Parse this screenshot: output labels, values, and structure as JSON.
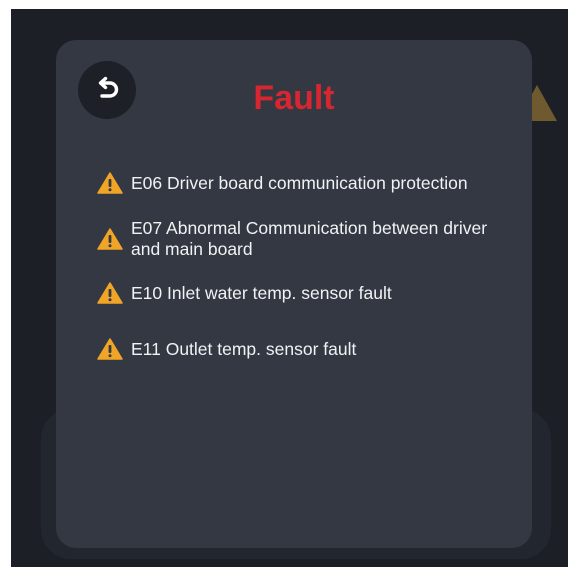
{
  "dialog": {
    "title": "Fault",
    "back_icon": "undo-arrow-icon",
    "warning_icon": "warning-triangle-icon",
    "colors": {
      "title": "#d6262f",
      "warning": "#f0a526",
      "dialog_bg": "#333843",
      "screen_bg": "#1c1f26"
    },
    "faults": [
      {
        "text": "E06 Driver board communication protection"
      },
      {
        "text": "E07 Abnormal Communication between driver and main board"
      },
      {
        "text": "E10 Inlet water temp. sensor fault"
      },
      {
        "text": "E11 Outlet temp. sensor fault"
      }
    ]
  }
}
